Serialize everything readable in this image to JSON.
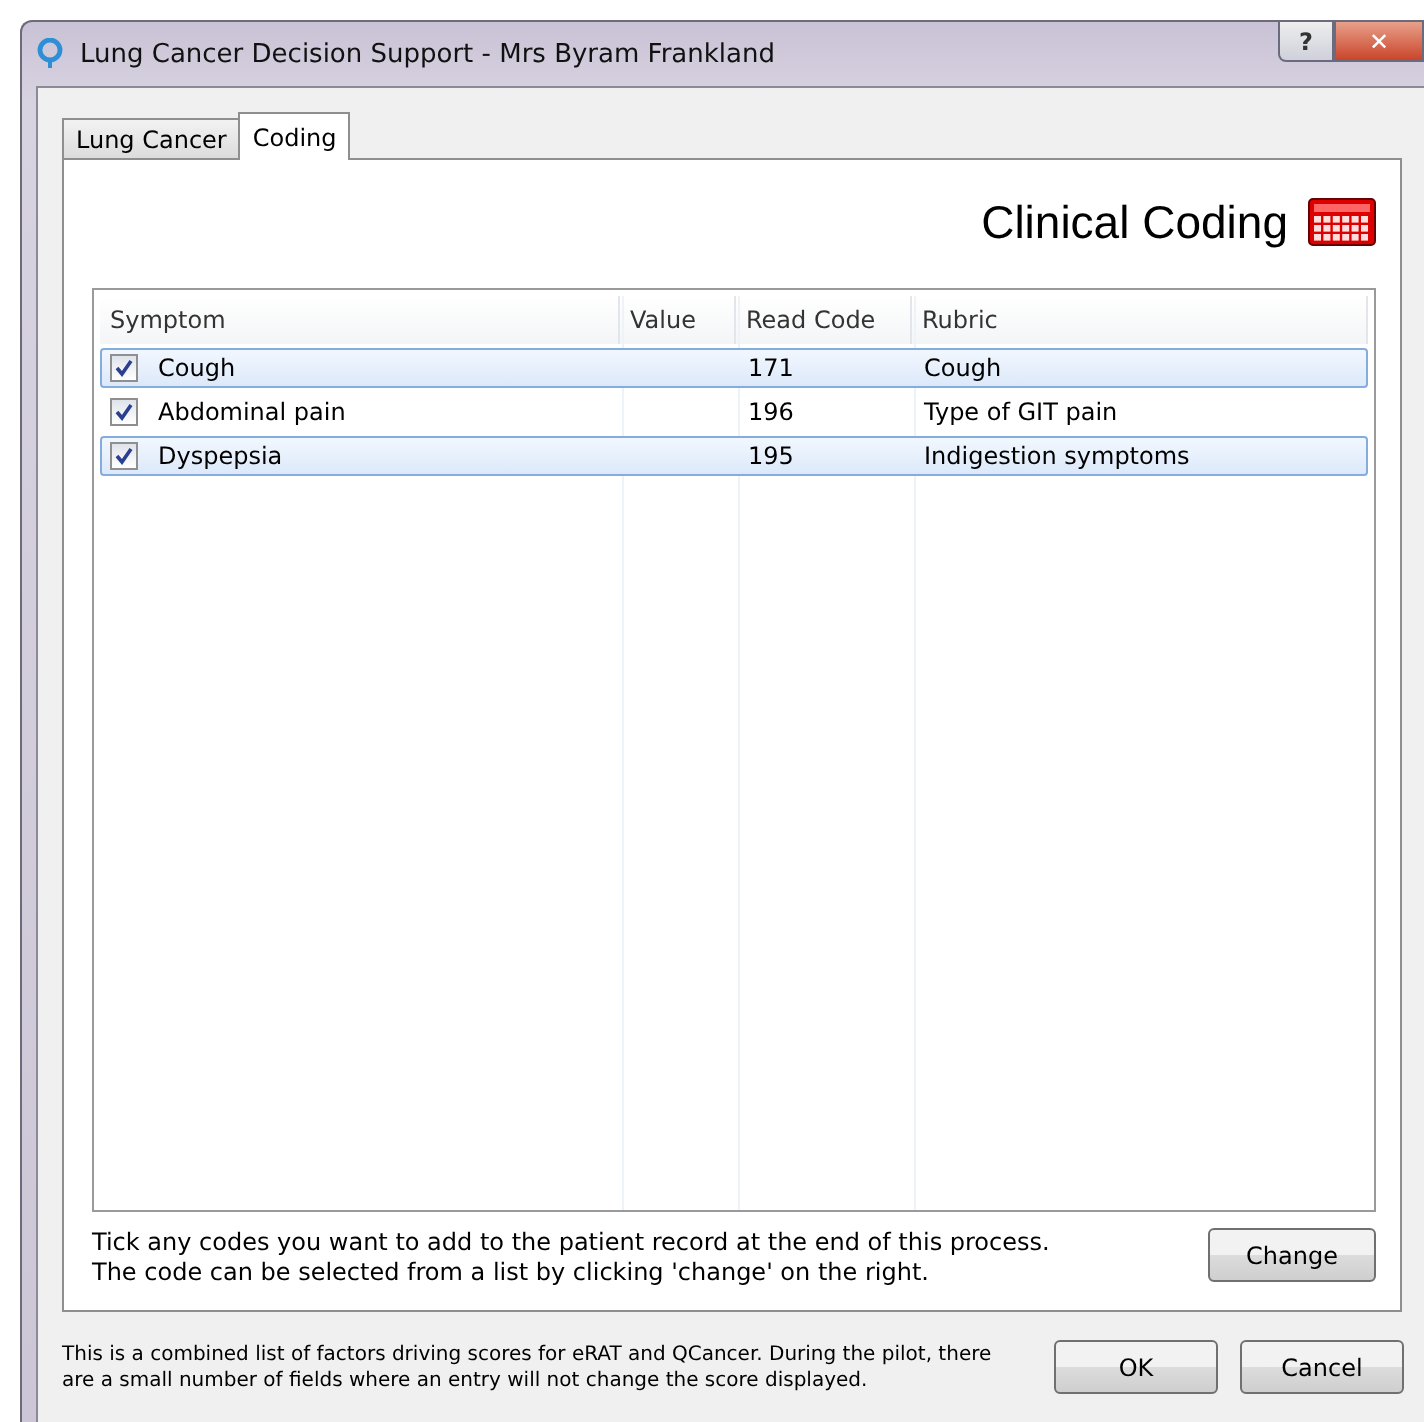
{
  "window": {
    "title": "Lung Cancer Decision Support - Mrs Byram Frankland",
    "help": "?",
    "close": "✕"
  },
  "tabs": [
    {
      "label": "Lung Cancer",
      "selected": false
    },
    {
      "label": "Coding",
      "selected": true
    }
  ],
  "heading": "Clinical Coding",
  "table": {
    "columns": [
      "Symptom",
      "Value",
      "Read Code",
      "Rubric"
    ],
    "rows": [
      {
        "symptom": "Cough",
        "read_code": "171",
        "rubric": "Cough",
        "checked": true,
        "selected": true
      },
      {
        "symptom": "Abdominal pain",
        "read_code": "196",
        "rubric": "Type of GIT pain",
        "checked": true,
        "selected": false
      },
      {
        "symptom": "Dyspepsia",
        "read_code": "195",
        "rubric": "Indigestion symptoms",
        "checked": true,
        "selected": true
      }
    ]
  },
  "instructions": [
    "Tick any codes you want to add to the patient record at the end of this process.",
    "The code can be selected from a list by clicking 'change' on the right."
  ],
  "change_button": "Change",
  "footer_note": "This is a combined list of factors driving scores for eRAT and QCancer. During the pilot, there are a small number of fields where an entry will not change the score displayed.",
  "buttons": [
    "OK",
    "Cancel"
  ]
}
